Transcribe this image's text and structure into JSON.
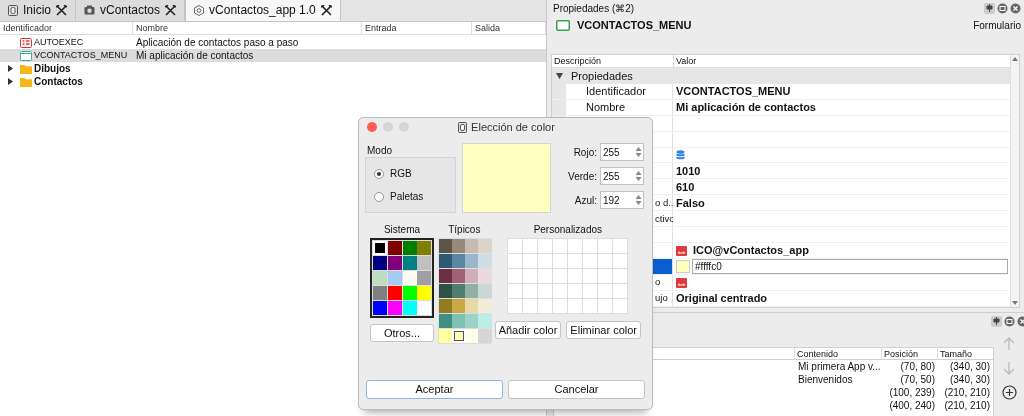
{
  "tabs": [
    {
      "label": "Inicio",
      "kind": "home",
      "selected": false
    },
    {
      "label": "vContactos",
      "kind": "project",
      "selected": false
    },
    {
      "label": "vContactos_app 1.0",
      "kind": "app",
      "selected": true
    }
  ],
  "tree": {
    "columns": [
      "Identificador",
      "Nombre",
      "Entrada",
      "Salida"
    ],
    "items": [
      {
        "kind": "process",
        "id": "AUTOEXEC",
        "name": "Aplicación de contactos paso a paso",
        "selected": false
      },
      {
        "kind": "form",
        "id": "VCONTACTOS_MENU",
        "name": "Mi aplicación de contactos",
        "selected": true
      },
      {
        "kind": "folder",
        "id": "Dibujos",
        "expanded": false,
        "selected": false
      },
      {
        "kind": "folder",
        "id": "Contactos",
        "expanded": false,
        "selected": false
      }
    ]
  },
  "properties": {
    "title": "Propiedades (⌘2)",
    "object": "VCONTACTOS_MENU",
    "object_type": "Formulario",
    "columns": [
      "Descripción",
      "Valor"
    ],
    "group": {
      "label": "Propiedades",
      "expanded": true
    },
    "rows": [
      {
        "kind": "text",
        "label": "Identificador",
        "value": "VCONTACTOS_MENU",
        "selected": false
      },
      {
        "kind": "text",
        "label": "Nombre",
        "value": "Mi aplicación de contactos",
        "selected": false
      },
      {
        "kind": "blank",
        "selected": false
      },
      {
        "kind": "blank",
        "selected": false
      },
      {
        "kind": "database",
        "selected": false
      },
      {
        "kind": "text",
        "value": "1010",
        "selected": false
      },
      {
        "kind": "text",
        "value": "610",
        "selected": false
      },
      {
        "kind": "text",
        "label": "o d...",
        "value": "Falso",
        "selected": false
      },
      {
        "kind": "text",
        "label": "ctivo",
        "selected": false
      },
      {
        "kind": "blank",
        "selected": false
      },
      {
        "kind": "image",
        "value": "ICO@vContactos_app",
        "selected": false
      },
      {
        "kind": "color",
        "value": "#ffffc0",
        "selected": true
      },
      {
        "kind": "image",
        "label": "o",
        "selected": false
      },
      {
        "kind": "text",
        "label": "ujo",
        "value": "Original centrado",
        "selected": false
      }
    ]
  },
  "elements": {
    "columns": [
      "Contenido",
      "Posición",
      "Tamaño"
    ],
    "rows": [
      {
        "content": "Mi primera App v...",
        "position": "(70, 80)",
        "size": "(340, 30)"
      },
      {
        "content": "Bienvenidos",
        "position": "(70, 50)",
        "size": "(340, 30)"
      },
      {
        "position": "(100, 239)",
        "size": "(210, 210)"
      },
      {
        "position": "(400, 240)",
        "size": "(210, 210)"
      }
    ]
  },
  "dialog": {
    "title": "Elección de color",
    "mode_label": "Modo",
    "modes": [
      {
        "label": "RGB",
        "selected": true
      },
      {
        "label": "Paletas",
        "selected": false
      }
    ],
    "preview": {
      "color": "#ffffc0"
    },
    "channels": [
      {
        "label": "Rojo:",
        "value": "255"
      },
      {
        "label": "Verde:",
        "value": "255"
      },
      {
        "label": "Azul:",
        "value": "192"
      }
    ],
    "system": {
      "title": "Sistema",
      "button": "Otros...",
      "colors": [
        {
          "color": "#000000",
          "selected": true
        },
        {
          "color": "#800000",
          "selected": false
        },
        {
          "color": "#008000",
          "selected": false
        },
        {
          "color": "#808000",
          "selected": false
        },
        {
          "color": "#000080",
          "selected": false
        },
        {
          "color": "#800080",
          "selected": false
        },
        {
          "color": "#008080",
          "selected": false
        },
        {
          "color": "#c0c0c0",
          "selected": false
        },
        {
          "color": "#c0dcc0",
          "selected": false
        },
        {
          "color": "#a6caf0",
          "selected": false
        },
        {
          "color": "#fffbf0",
          "selected": false
        },
        {
          "color": "#a0a0a4",
          "selected": false
        },
        {
          "color": "#808080",
          "selected": false
        },
        {
          "color": "#ff0000",
          "selected": false
        },
        {
          "color": "#00ff00",
          "selected": false
        },
        {
          "color": "#ffff00",
          "selected": false
        },
        {
          "color": "#0000ff",
          "selected": false
        },
        {
          "color": "#ff00ff",
          "selected": false
        },
        {
          "color": "#00ffff",
          "selected": false
        },
        {
          "color": "#ffffff",
          "selected": false
        }
      ]
    },
    "typical": {
      "title": "Típicos",
      "colors": [
        {
          "color": "#5d5548",
          "selected": false
        },
        {
          "color": "#978a7a",
          "selected": false
        },
        {
          "color": "#c5bbb2",
          "selected": false
        },
        {
          "color": "#dcd4ca",
          "selected": false
        },
        {
          "color": "#2f5873",
          "selected": false
        },
        {
          "color": "#5a86a3",
          "selected": false
        },
        {
          "color": "#9ab6cb",
          "selected": false
        },
        {
          "color": "#d1dde5",
          "selected": false
        },
        {
          "color": "#6d2f45",
          "selected": false
        },
        {
          "color": "#a36072",
          "selected": false
        },
        {
          "color": "#d2aeb9",
          "selected": false
        },
        {
          "color": "#ead9e0",
          "selected": false
        },
        {
          "color": "#2e5248",
          "selected": false
        },
        {
          "color": "#4f7d6f",
          "selected": false
        },
        {
          "color": "#8fb0a4",
          "selected": false
        },
        {
          "color": "#c8d8d2",
          "selected": false
        },
        {
          "color": "#927c20",
          "selected": false
        },
        {
          "color": "#c9a848",
          "selected": false
        },
        {
          "color": "#ead9a8",
          "selected": false
        },
        {
          "color": "#f2ecd8",
          "selected": false
        },
        {
          "color": "#3f8f82",
          "selected": false
        },
        {
          "color": "#80c0b5",
          "selected": false
        },
        {
          "color": "#9ed2c8",
          "selected": false
        },
        {
          "color": "#bdeee4",
          "selected": false
        },
        {
          "color": "#ffffa0",
          "selected": false
        },
        {
          "color": "#ffffc0",
          "selected": true
        },
        {
          "color": "#fffee6",
          "selected": false
        },
        {
          "color": "#d6d6d6",
          "selected": false
        }
      ]
    },
    "custom": {
      "title": "Personalizados",
      "buttons": [
        "Añadir color",
        "Eliminar color"
      ]
    },
    "buttons": [
      {
        "label": "Aceptar",
        "default": true
      },
      {
        "label": "Cancelar",
        "default": false
      }
    ]
  }
}
